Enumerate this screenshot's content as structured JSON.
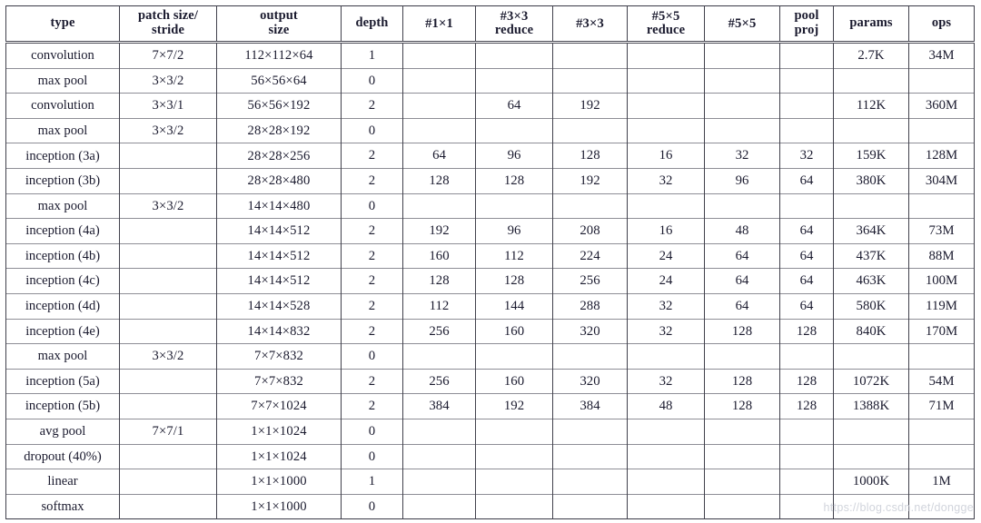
{
  "document": {
    "kind": "architecture-table",
    "watermark": "https://blog.csdn.net/dongge"
  },
  "table": {
    "columns": [
      {
        "id": "type",
        "label_line1": "type",
        "label_line2": ""
      },
      {
        "id": "patch",
        "label_line1": "patch size/",
        "label_line2": "stride"
      },
      {
        "id": "output",
        "label_line1": "output",
        "label_line2": "size"
      },
      {
        "id": "depth",
        "label_line1": "depth",
        "label_line2": ""
      },
      {
        "id": "c1x1",
        "label_line1": "#1×1",
        "label_line2": ""
      },
      {
        "id": "c3x3reduce",
        "label_line1": "#3×3",
        "label_line2": "reduce"
      },
      {
        "id": "c3x3",
        "label_line1": "#3×3",
        "label_line2": ""
      },
      {
        "id": "c5x5reduce",
        "label_line1": "#5×5",
        "label_line2": "reduce"
      },
      {
        "id": "c5x5",
        "label_line1": "#5×5",
        "label_line2": ""
      },
      {
        "id": "poolproj",
        "label_line1": "pool",
        "label_line2": "proj"
      },
      {
        "id": "params",
        "label_line1": "params",
        "label_line2": ""
      },
      {
        "id": "ops",
        "label_line1": "ops",
        "label_line2": ""
      }
    ],
    "rows": [
      {
        "type": "convolution",
        "patch": "7×7/2",
        "output": "112×112×64",
        "depth": "1",
        "c1x1": "",
        "c3x3reduce": "",
        "c3x3": "",
        "c5x5reduce": "",
        "c5x5": "",
        "poolproj": "",
        "params": "2.7K",
        "ops": "34M"
      },
      {
        "type": "max pool",
        "patch": "3×3/2",
        "output": "56×56×64",
        "depth": "0",
        "c1x1": "",
        "c3x3reduce": "",
        "c3x3": "",
        "c5x5reduce": "",
        "c5x5": "",
        "poolproj": "",
        "params": "",
        "ops": ""
      },
      {
        "type": "convolution",
        "patch": "3×3/1",
        "output": "56×56×192",
        "depth": "2",
        "c1x1": "",
        "c3x3reduce": "64",
        "c3x3": "192",
        "c5x5reduce": "",
        "c5x5": "",
        "poolproj": "",
        "params": "112K",
        "ops": "360M"
      },
      {
        "type": "max pool",
        "patch": "3×3/2",
        "output": "28×28×192",
        "depth": "0",
        "c1x1": "",
        "c3x3reduce": "",
        "c3x3": "",
        "c5x5reduce": "",
        "c5x5": "",
        "poolproj": "",
        "params": "",
        "ops": ""
      },
      {
        "type": "inception (3a)",
        "patch": "",
        "output": "28×28×256",
        "depth": "2",
        "c1x1": "64",
        "c3x3reduce": "96",
        "c3x3": "128",
        "c5x5reduce": "16",
        "c5x5": "32",
        "poolproj": "32",
        "params": "159K",
        "ops": "128M"
      },
      {
        "type": "inception (3b)",
        "patch": "",
        "output": "28×28×480",
        "depth": "2",
        "c1x1": "128",
        "c3x3reduce": "128",
        "c3x3": "192",
        "c5x5reduce": "32",
        "c5x5": "96",
        "poolproj": "64",
        "params": "380K",
        "ops": "304M"
      },
      {
        "type": "max pool",
        "patch": "3×3/2",
        "output": "14×14×480",
        "depth": "0",
        "c1x1": "",
        "c3x3reduce": "",
        "c3x3": "",
        "c5x5reduce": "",
        "c5x5": "",
        "poolproj": "",
        "params": "",
        "ops": ""
      },
      {
        "type": "inception (4a)",
        "patch": "",
        "output": "14×14×512",
        "depth": "2",
        "c1x1": "192",
        "c3x3reduce": "96",
        "c3x3": "208",
        "c5x5reduce": "16",
        "c5x5": "48",
        "poolproj": "64",
        "params": "364K",
        "ops": "73M"
      },
      {
        "type": "inception (4b)",
        "patch": "",
        "output": "14×14×512",
        "depth": "2",
        "c1x1": "160",
        "c3x3reduce": "112",
        "c3x3": "224",
        "c5x5reduce": "24",
        "c5x5": "64",
        "poolproj": "64",
        "params": "437K",
        "ops": "88M"
      },
      {
        "type": "inception (4c)",
        "patch": "",
        "output": "14×14×512",
        "depth": "2",
        "c1x1": "128",
        "c3x3reduce": "128",
        "c3x3": "256",
        "c5x5reduce": "24",
        "c5x5": "64",
        "poolproj": "64",
        "params": "463K",
        "ops": "100M"
      },
      {
        "type": "inception (4d)",
        "patch": "",
        "output": "14×14×528",
        "depth": "2",
        "c1x1": "112",
        "c3x3reduce": "144",
        "c3x3": "288",
        "c5x5reduce": "32",
        "c5x5": "64",
        "poolproj": "64",
        "params": "580K",
        "ops": "119M"
      },
      {
        "type": "inception (4e)",
        "patch": "",
        "output": "14×14×832",
        "depth": "2",
        "c1x1": "256",
        "c3x3reduce": "160",
        "c3x3": "320",
        "c5x5reduce": "32",
        "c5x5": "128",
        "poolproj": "128",
        "params": "840K",
        "ops": "170M"
      },
      {
        "type": "max pool",
        "patch": "3×3/2",
        "output": "7×7×832",
        "depth": "0",
        "c1x1": "",
        "c3x3reduce": "",
        "c3x3": "",
        "c5x5reduce": "",
        "c5x5": "",
        "poolproj": "",
        "params": "",
        "ops": ""
      },
      {
        "type": "inception (5a)",
        "patch": "",
        "output": "7×7×832",
        "depth": "2",
        "c1x1": "256",
        "c3x3reduce": "160",
        "c3x3": "320",
        "c5x5reduce": "32",
        "c5x5": "128",
        "poolproj": "128",
        "params": "1072K",
        "ops": "54M"
      },
      {
        "type": "inception (5b)",
        "patch": "",
        "output": "7×7×1024",
        "depth": "2",
        "c1x1": "384",
        "c3x3reduce": "192",
        "c3x3": "384",
        "c5x5reduce": "48",
        "c5x5": "128",
        "poolproj": "128",
        "params": "1388K",
        "ops": "71M"
      },
      {
        "type": "avg pool",
        "patch": "7×7/1",
        "output": "1×1×1024",
        "depth": "0",
        "c1x1": "",
        "c3x3reduce": "",
        "c3x3": "",
        "c5x5reduce": "",
        "c5x5": "",
        "poolproj": "",
        "params": "",
        "ops": ""
      },
      {
        "type": "dropout (40%)",
        "patch": "",
        "output": "1×1×1024",
        "depth": "0",
        "c1x1": "",
        "c3x3reduce": "",
        "c3x3": "",
        "c5x5reduce": "",
        "c5x5": "",
        "poolproj": "",
        "params": "",
        "ops": ""
      },
      {
        "type": "linear",
        "patch": "",
        "output": "1×1×1000",
        "depth": "1",
        "c1x1": "",
        "c3x3reduce": "",
        "c3x3": "",
        "c5x5reduce": "",
        "c5x5": "",
        "poolproj": "",
        "params": "1000K",
        "ops": "1M"
      },
      {
        "type": "softmax",
        "patch": "",
        "output": "1×1×1000",
        "depth": "0",
        "c1x1": "",
        "c3x3reduce": "",
        "c3x3": "",
        "c5x5reduce": "",
        "c5x5": "",
        "poolproj": "",
        "params": "",
        "ops": ""
      }
    ]
  }
}
